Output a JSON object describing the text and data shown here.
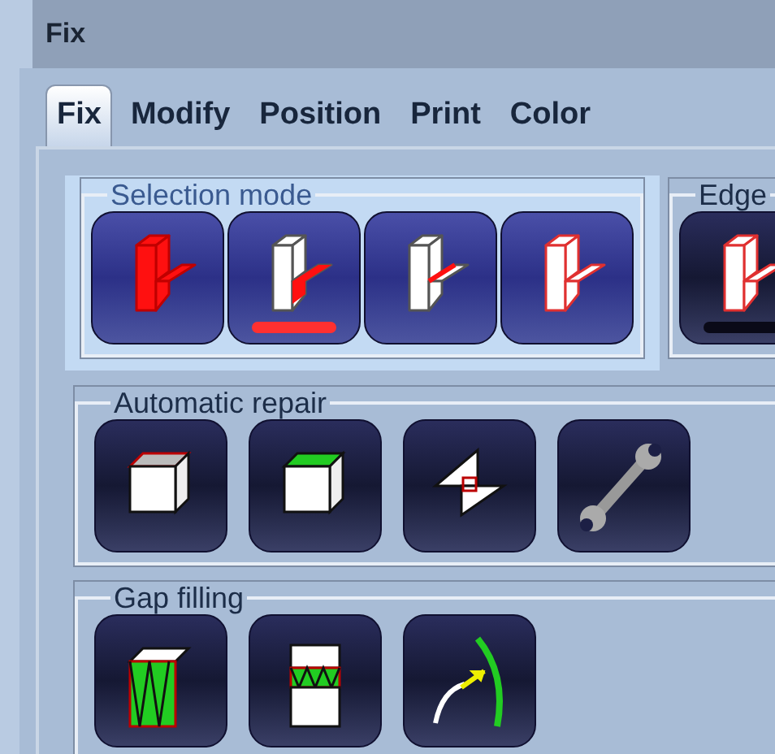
{
  "window": {
    "title": "Fix"
  },
  "tabs": [
    {
      "label": "Fix",
      "selected": true
    },
    {
      "label": "Modify",
      "selected": false
    },
    {
      "label": "Position",
      "selected": false
    },
    {
      "label": "Print",
      "selected": false
    },
    {
      "label": "Color",
      "selected": false
    }
  ],
  "groups": [
    {
      "legend": "Selection mode",
      "highlighted": true,
      "buttons": [
        {
          "kind": "solid",
          "selected": false
        },
        {
          "kind": "face",
          "selected": true
        },
        {
          "kind": "edge",
          "selected": false
        },
        {
          "kind": "outline",
          "selected": false
        }
      ]
    },
    {
      "legend": "Edge",
      "highlighted": false,
      "buttons": [
        {
          "kind": "outline",
          "selected": true
        }
      ]
    },
    {
      "legend": "Automatic repair",
      "highlighted": false,
      "buttons": [
        {
          "kind": "open-box",
          "selected": false
        },
        {
          "kind": "green-top-box",
          "selected": false
        },
        {
          "kind": "flipped-triangles",
          "selected": false
        },
        {
          "kind": "wrench",
          "selected": false
        }
      ]
    },
    {
      "legend": "Gap filling",
      "highlighted": false,
      "buttons": [
        {
          "kind": "mesh-box",
          "selected": false
        },
        {
          "kind": "mesh-strip",
          "selected": false
        },
        {
          "kind": "curve-arrow",
          "selected": false
        }
      ]
    }
  ]
}
